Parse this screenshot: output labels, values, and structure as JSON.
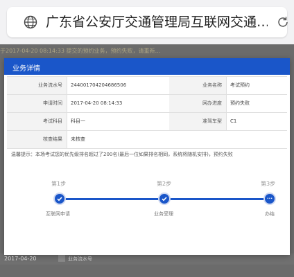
{
  "browser": {
    "title": "广东省公安厅交通管理局互联网交通…",
    "globe_icon": "globe-icon",
    "reload_icon": "reload-icon"
  },
  "background": {
    "notice": "于2017-04-20 08:14:33 提交的预约业务，预约失败，请重新…",
    "date": "2017-04-20",
    "row_label": "业务流水号"
  },
  "modal": {
    "title": "业务详情",
    "rows": [
      {
        "label_left": "业务流水号",
        "value_left": "244001704204686506",
        "label_right": "业务名称",
        "value_right": "考试预约"
      },
      {
        "label_left": "申请时间",
        "value_left": "2017-04-20 08:14:33",
        "label_right": "网办进度",
        "value_right": "预约失败"
      },
      {
        "label_left": "考试科目",
        "value_left": "科目一",
        "label_right": "准驾车型",
        "value_right": "C1"
      },
      {
        "label_left": "核查结果",
        "value_left": "未核查",
        "label_right": "",
        "value_right": ""
      }
    ],
    "tip": "温馨提示：本场考试您的优先级排名超过了200名(最后一位如果排名相同，系统将随机安排)，预约失败",
    "steps": [
      {
        "num": "第1步",
        "name": "互联网申请",
        "state": "done"
      },
      {
        "num": "第2步",
        "name": "业务受理",
        "state": "done"
      },
      {
        "num": "第3步",
        "name": "办结",
        "state": "pending",
        "mark": "..."
      }
    ]
  },
  "colors": {
    "accent": "#1a56c9",
    "overlay": "#6b6b6b"
  }
}
